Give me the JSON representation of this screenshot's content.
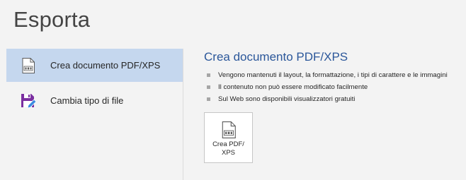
{
  "header": {
    "title": "Esporta"
  },
  "options": [
    {
      "label": "Crea documento PDF/XPS",
      "icon": "pdf-document-icon",
      "selected": true
    },
    {
      "label": "Cambia tipo di file",
      "icon": "save-as-icon",
      "selected": false
    }
  ],
  "detail": {
    "title": "Crea documento PDF/XPS",
    "bullets": [
      "Vengono mantenuti il layout, la formattazione, i tipi di carattere e le immagini",
      "Il contenuto non può essere modificato facilmente",
      "Sul Web sono disponibili visualizzatori gratuiti"
    ],
    "button_label": "Crea PDF/\nXPS",
    "button_icon": "pdf-document-icon"
  },
  "colors": {
    "background": "#f3f3f3",
    "selected": "#c5d7ee",
    "title_accent": "#2b579a",
    "save_icon_purple": "#7b2fa0",
    "save_icon_pen": "#3b8be0"
  }
}
